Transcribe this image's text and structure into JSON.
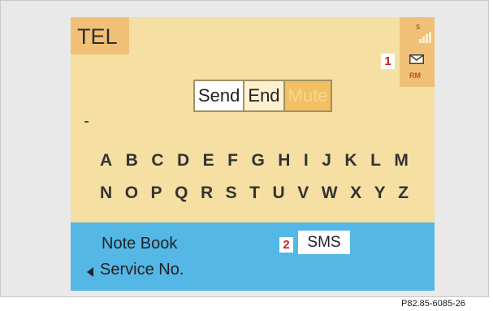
{
  "screen": {
    "title": "TEL",
    "status": {
      "signal_label": "S",
      "icon": "envelope-icon",
      "indicator": "RM"
    },
    "softkeys": {
      "send": "Send",
      "end": "End",
      "mute": "Mute"
    },
    "cursor": "_",
    "alphabet": {
      "row1": [
        "A",
        "B",
        "C",
        "D",
        "E",
        "F",
        "G",
        "H",
        "I",
        "J",
        "K",
        "L",
        "M"
      ],
      "row2": [
        "N",
        "O",
        "P",
        "Q",
        "R",
        "S",
        "T",
        "U",
        "V",
        "W",
        "X",
        "Y",
        "Z"
      ]
    },
    "bottom": {
      "note_book": "Note Book",
      "service": "Service No.",
      "sms": "SMS"
    }
  },
  "callouts": [
    "1",
    "2"
  ],
  "caption": "P82.85-6085-26"
}
